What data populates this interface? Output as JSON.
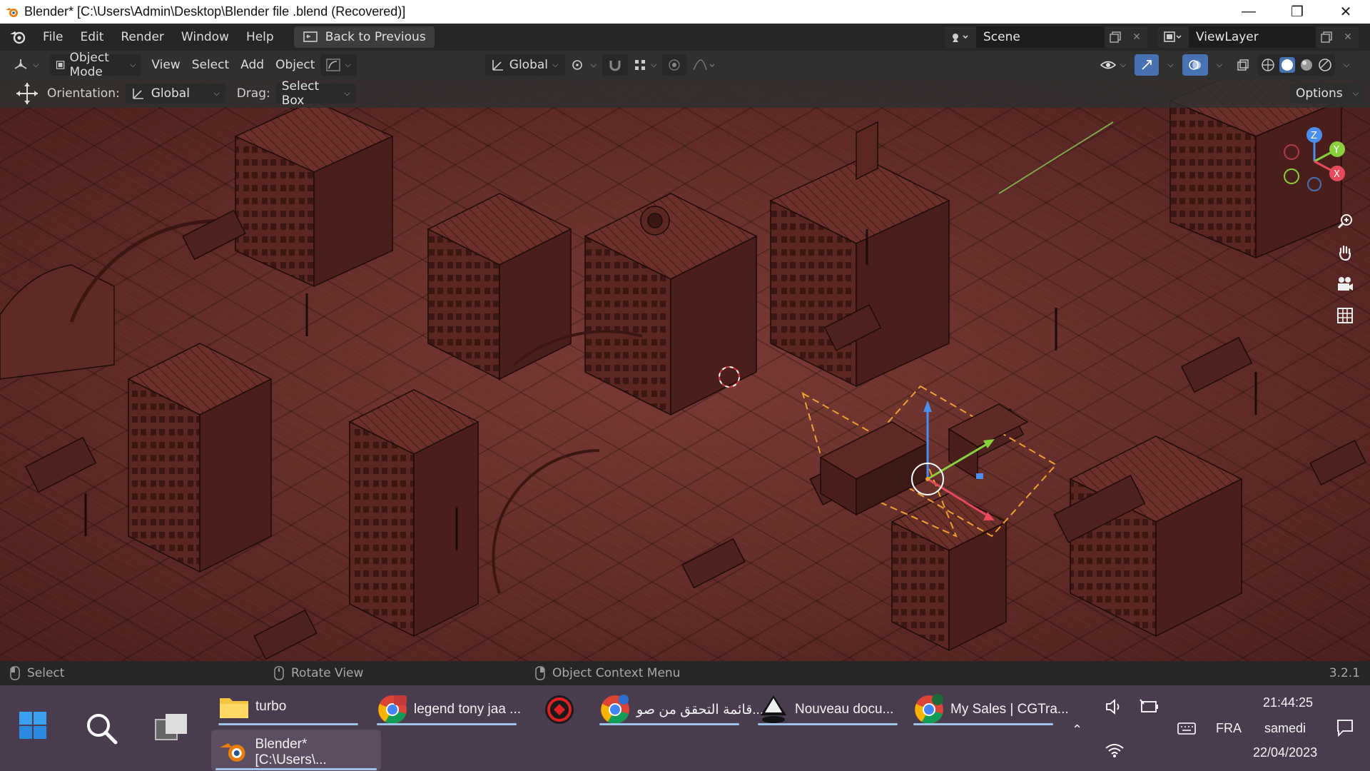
{
  "window": {
    "title": "Blender* [C:\\Users\\Admin\\Desktop\\Blender file .blend (Recovered)]",
    "minimize": "—",
    "maximize": "❐",
    "close": "✕"
  },
  "menubar": {
    "items": [
      "File",
      "Edit",
      "Render",
      "Window",
      "Help"
    ],
    "back_button": "Back to Previous",
    "scene_label": "Scene",
    "viewlayer_label": "ViewLayer"
  },
  "header": {
    "mode": "Object Mode",
    "menus": [
      "View",
      "Select",
      "Add",
      "Object"
    ],
    "transform_orientation": "Global"
  },
  "tool_settings": {
    "orientation_label": "Orientation:",
    "orientation_value": "Global",
    "drag_label": "Drag:",
    "drag_value": "Select Box",
    "options": "Options"
  },
  "gizmo": {
    "z": "Z",
    "y": "Y",
    "x": "X"
  },
  "statusbar": {
    "select": "Select",
    "rotate": "Rotate View",
    "context": "Object Context Menu",
    "version": "3.2.1"
  },
  "taskbar": {
    "apps": [
      {
        "label": "turbo",
        "icon": "folder-icon"
      },
      {
        "label": "legend tony jaa ...",
        "icon": "chrome-icon"
      },
      {
        "label": "",
        "icon": "app-red-icon"
      },
      {
        "label": "قائمة التحقق من صو...",
        "icon": "chrome-icon"
      },
      {
        "label": "Nouveau docu...",
        "icon": "inkscape-icon"
      },
      {
        "label": "My Sales | CGTra...",
        "icon": "chrome-icon"
      }
    ],
    "blender_label": "Blender* [C:\\Users\\...",
    "time": "21:44:25",
    "day": "samedi",
    "date": "22/04/2023",
    "lang": "FRA"
  }
}
